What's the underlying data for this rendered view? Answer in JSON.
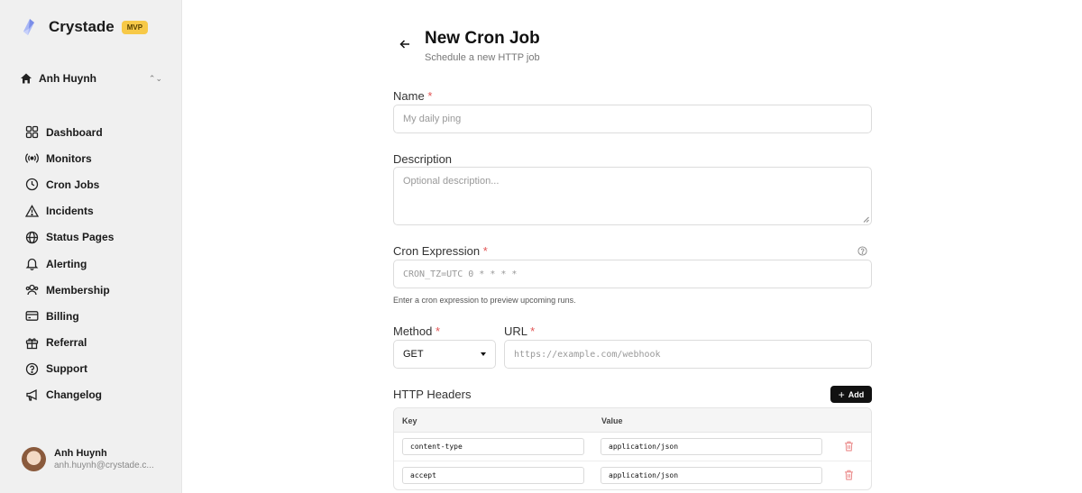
{
  "app": {
    "name": "Crystade",
    "badge": "MVP"
  },
  "workspace": {
    "name": "Anh Huynh"
  },
  "nav": [
    {
      "label": "Dashboard",
      "icon": "grid-icon"
    },
    {
      "label": "Monitors",
      "icon": "broadcast-icon"
    },
    {
      "label": "Cron Jobs",
      "icon": "clock-icon"
    },
    {
      "label": "Incidents",
      "icon": "warning-icon"
    },
    {
      "label": "Status Pages",
      "icon": "globe-icon"
    },
    {
      "label": "Alerting",
      "icon": "bell-icon"
    },
    {
      "label": "Membership",
      "icon": "users-icon"
    },
    {
      "label": "Billing",
      "icon": "card-icon"
    },
    {
      "label": "Referral",
      "icon": "gift-icon"
    },
    {
      "label": "Support",
      "icon": "help-circle-icon"
    },
    {
      "label": "Changelog",
      "icon": "megaphone-icon"
    }
  ],
  "user": {
    "name": "Anh Huynh",
    "email": "anh.huynh@crystade.c..."
  },
  "page": {
    "title": "New Cron Job",
    "subtitle": "Schedule a new HTTP job"
  },
  "form": {
    "name_label": "Name",
    "name_placeholder": "My daily ping",
    "description_label": "Description",
    "description_placeholder": "Optional description...",
    "cron_label": "Cron Expression",
    "cron_placeholder": "CRON_TZ=UTC 0 * * * *",
    "cron_hint": "Enter a cron expression to preview upcoming runs.",
    "method_label": "Method",
    "method_value": "GET",
    "url_label": "URL",
    "url_placeholder": "https://example.com/webhook",
    "required_mark": "*"
  },
  "headers": {
    "title": "HTTP Headers",
    "add_label": "Add",
    "key_col": "Key",
    "value_col": "Value",
    "rows": [
      {
        "key": "content-type",
        "value": "application/json"
      },
      {
        "key": "accept",
        "value": "application/json"
      }
    ]
  },
  "colors": {
    "accent": "#111111",
    "required": "#e25555",
    "badge": "#f7c948",
    "sidebar": "#f0f0f0"
  }
}
